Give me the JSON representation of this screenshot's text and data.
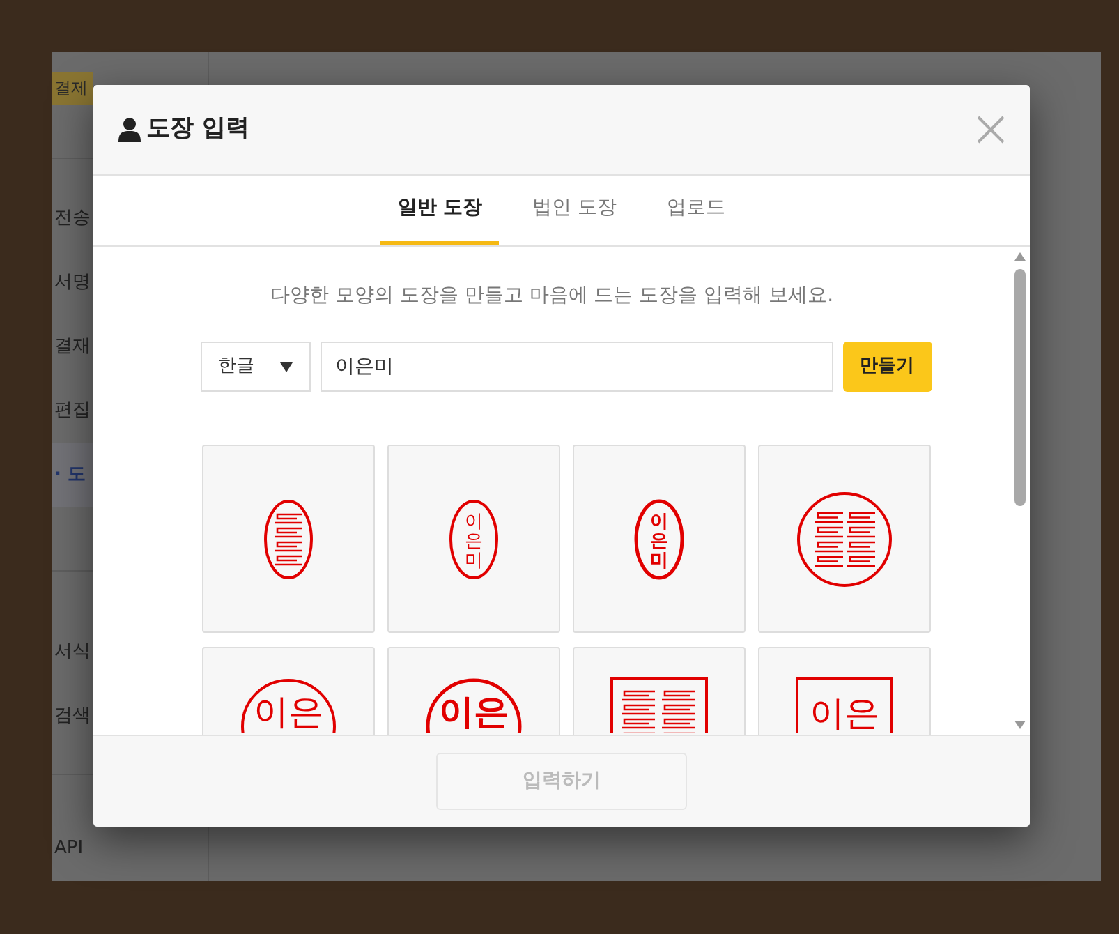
{
  "background_app": {
    "top_button": "결제",
    "menu": [
      {
        "label": "전송",
        "selected": false
      },
      {
        "label": "서명",
        "selected": false
      },
      {
        "label": "결재",
        "selected": false
      },
      {
        "label": "편집",
        "selected": false
      },
      {
        "label": "· 도",
        "selected": true
      },
      {
        "label": "서식",
        "selected": false
      },
      {
        "label": "검색",
        "selected": false
      },
      {
        "label": "API",
        "selected": false
      }
    ]
  },
  "dialog": {
    "title": "도장 입력",
    "tabs": [
      {
        "label": "일반 도장",
        "selected": true
      },
      {
        "label": "법인 도장",
        "selected": false
      },
      {
        "label": "업로드",
        "selected": false
      }
    ],
    "description": "다양한 모양의 도장을 만들고 마음에 드는 도장을 입력해 보세요.",
    "language_select": {
      "value": "한글"
    },
    "name_field": {
      "value": "이은미"
    },
    "make_button": "만들기",
    "stamps": [
      {
        "kind": "oval"
      },
      {
        "kind": "oval",
        "bold": false,
        "text": "이은미"
      },
      {
        "kind": "oval",
        "bold": true,
        "text": "이은미"
      },
      {
        "kind": "circle"
      },
      {
        "kind": "circle",
        "bold": false,
        "text": "이은"
      },
      {
        "kind": "circle",
        "bold": true,
        "text": "이은"
      },
      {
        "kind": "square"
      },
      {
        "kind": "square",
        "bold": false,
        "text": "이은"
      }
    ],
    "submit_button": {
      "label": "입력하기",
      "disabled": true
    }
  }
}
